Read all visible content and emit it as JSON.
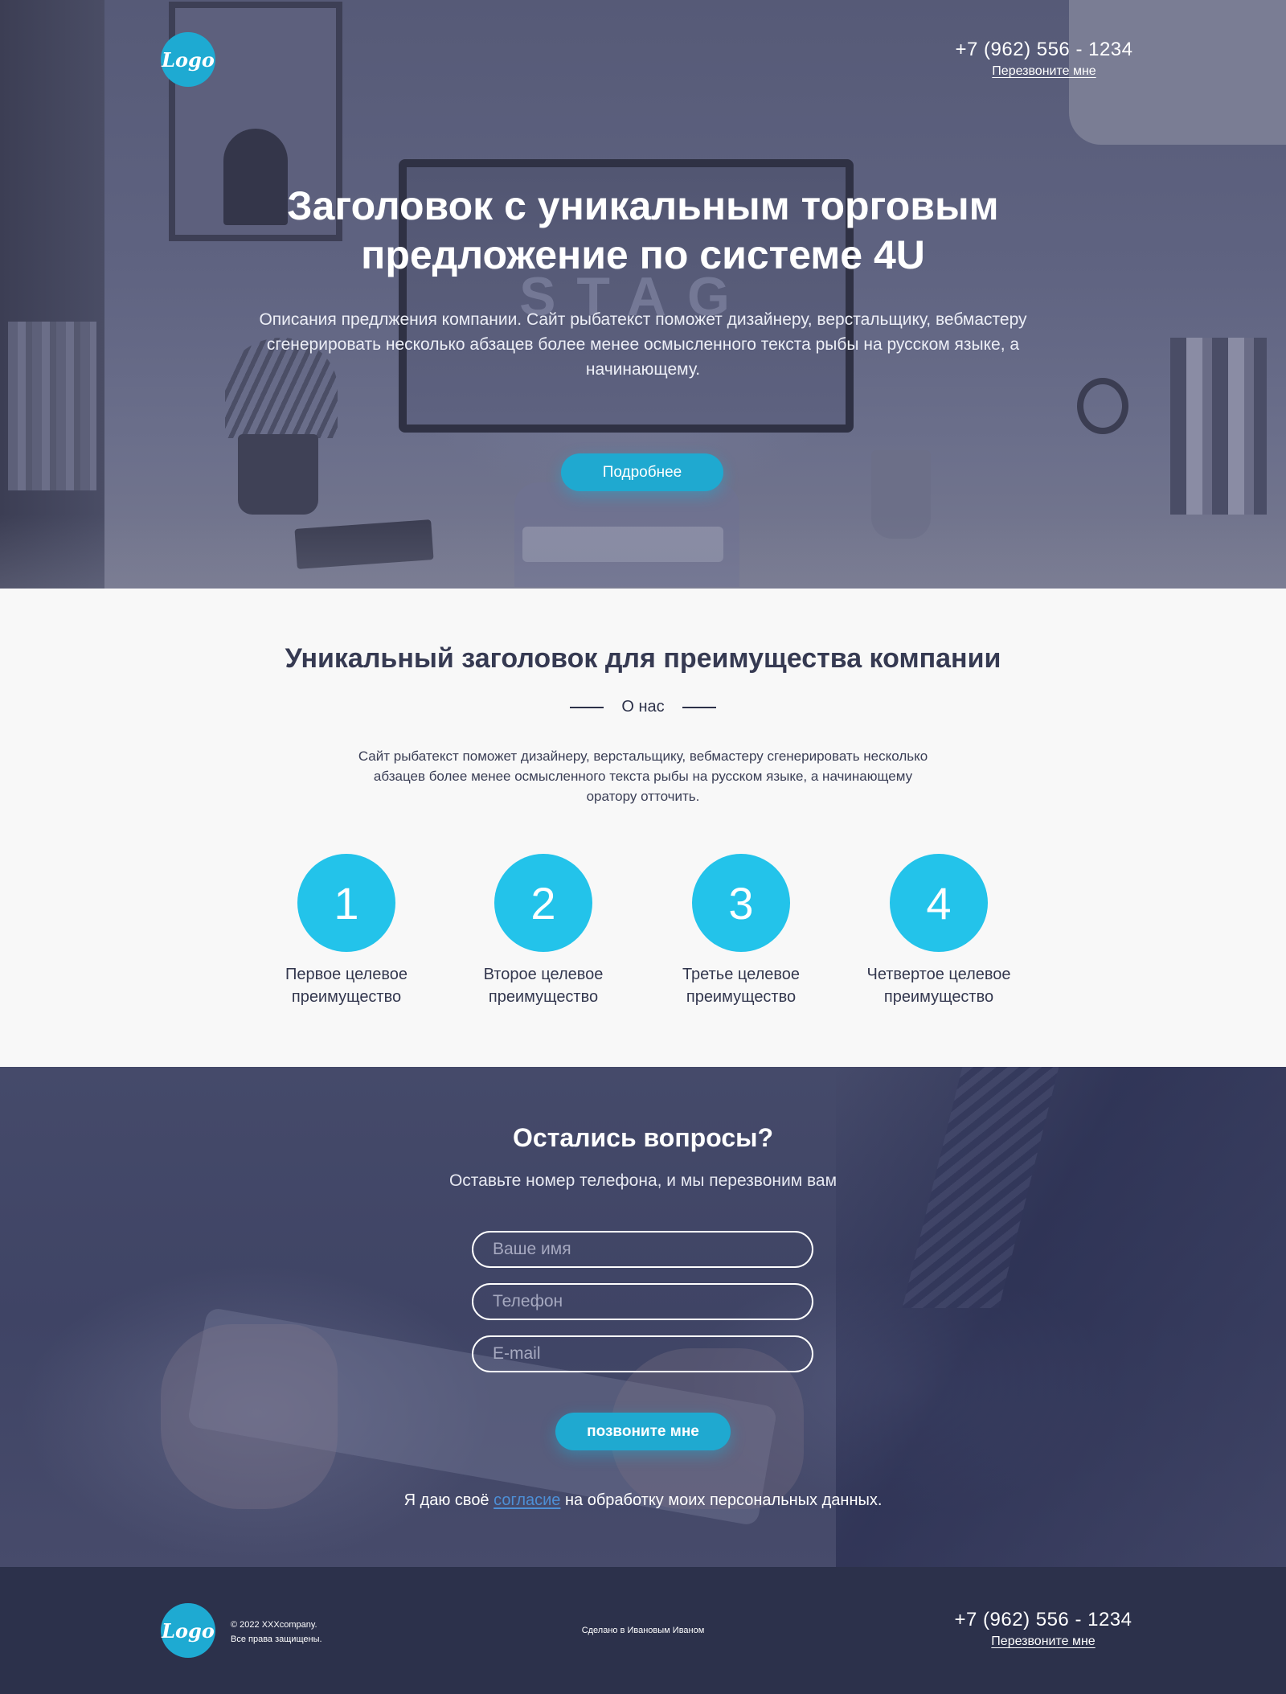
{
  "hero": {
    "logo_text": "Logo",
    "phone": "+7 (962) 556 - 1234",
    "callback_label": "Перезвоните мне",
    "title_line1": "Заголовок с уникальным торговым",
    "title_line2": "предложение по системе 4U",
    "description": "Описания предлжения компании. Сайт рыбатекст поможет дизайнеру, верстальщику, вебмастеру сгенерировать несколько абзацев более менее осмысленного текста рыбы на русском языке, а начинающему.",
    "button_label": "Подробнее",
    "background_word": "STAG"
  },
  "about": {
    "title": "Уникальный заголовок для преимущества компании",
    "subtitle": "О нас",
    "text": "Сайт рыбатекст поможет дизайнеру, верстальщику, вебмастеру сгенерировать несколько абзацев более менее осмысленного текста рыбы на русском языке, а начинающему оратору отточить.",
    "benefits": [
      {
        "number": "1",
        "label_line1": "Первое целевое",
        "label_line2": "преимущество"
      },
      {
        "number": "2",
        "label_line1": "Второе целевое",
        "label_line2": "преимущество"
      },
      {
        "number": "3",
        "label_line1": "Третье целевое",
        "label_line2": "преимущество"
      },
      {
        "number": "4",
        "label_line1": "Четвертое целевое",
        "label_line2": "преимущество"
      }
    ]
  },
  "form": {
    "title": "Остались вопросы?",
    "subtitle": "Оставьте номер телефона, и мы перезвоним вам",
    "name_placeholder": "Ваше имя",
    "phone_placeholder": "Телефон",
    "email_placeholder": "E-mail",
    "button_label": "позвоните мне",
    "consent_prefix": "Я даю своё ",
    "consent_link": "согласие",
    "consent_suffix": " на обработку моих персональных данных."
  },
  "footer": {
    "logo_text": "Logo",
    "copyright_line1": "© 2022 XXXcompany.",
    "copyright_line2": "Все права защищены.",
    "made_by": "Сделано в Ивановым Иваном",
    "phone": "+7 (962) 556 - 1234",
    "callback_label": "Перезвоните мне"
  },
  "colors": {
    "accent": "#1fa9d0",
    "benefit_circle": "#23c3ea",
    "hero_overlay": "#5f6381",
    "form_overlay": "#3f4465",
    "footer_bg": "#2c314b",
    "about_bg": "#f8f8f8",
    "consent_link": "#4d8fd6"
  }
}
